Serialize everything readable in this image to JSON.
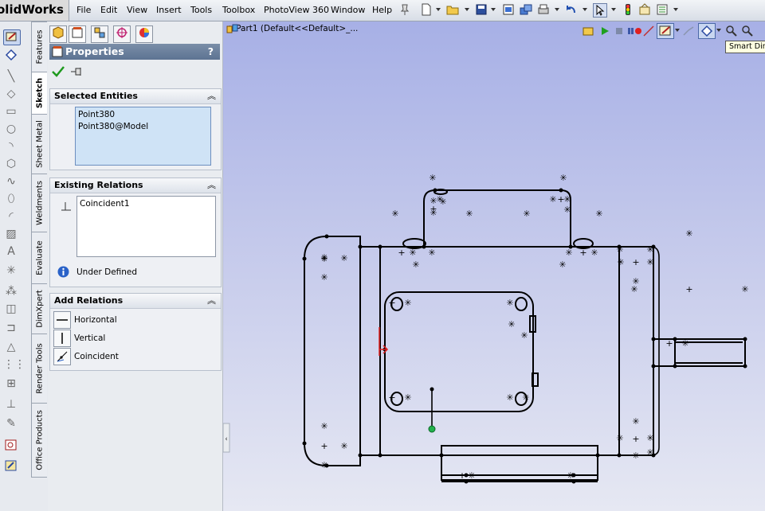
{
  "app": {
    "brand_text": "olidWorks"
  },
  "menu": [
    "File",
    "Edit",
    "View",
    "Insert",
    "Tools",
    "Toolbox",
    "PhotoView 360",
    "Window",
    "Help"
  ],
  "vertical_tabs": [
    "Features",
    "Sketch",
    "Sheet Metal",
    "Weldments",
    "Evaluate",
    "DimXpert",
    "Render Tools",
    "Office Products"
  ],
  "property_manager": {
    "title": "Properties",
    "help_glyph": "?",
    "selected_entities": {
      "heading": "Selected Entities",
      "items": [
        "Point380",
        "Point380@Model"
      ]
    },
    "existing_relations": {
      "heading": "Existing Relations",
      "items": [
        "Coincident1"
      ],
      "status": "Under Defined"
    },
    "add_relations": {
      "heading": "Add Relations",
      "items": [
        "Horizontal",
        "Vertical",
        "Coincident"
      ]
    }
  },
  "graphics": {
    "tree_root": "Part1  (Default<<Default>_...",
    "tooltip": "Smart Dim"
  },
  "colors": {
    "accent": "#4a68a8",
    "panel_title": "#6b81a0",
    "selection": "#cfe3f6",
    "highlight_point": "#22b14c",
    "relation_red": "#e02020"
  },
  "icons": [
    "sketch-icon",
    "smart-dimension-icon",
    "line-icon",
    "rectangle-icon",
    "slot-icon",
    "circle-icon",
    "arc-icon",
    "polygon-icon",
    "spline-icon",
    "ellipse-icon",
    "fillet-icon",
    "plane-icon",
    "text-icon",
    "point-icon",
    "centerline-icon",
    "trim-icon",
    "convert-icon",
    "offset-icon",
    "mirror-icon",
    "pattern-icon",
    "move-icon",
    "relations-icon",
    "repair-icon",
    "quick-snaps-icon",
    "rapid-sketch-icon"
  ]
}
